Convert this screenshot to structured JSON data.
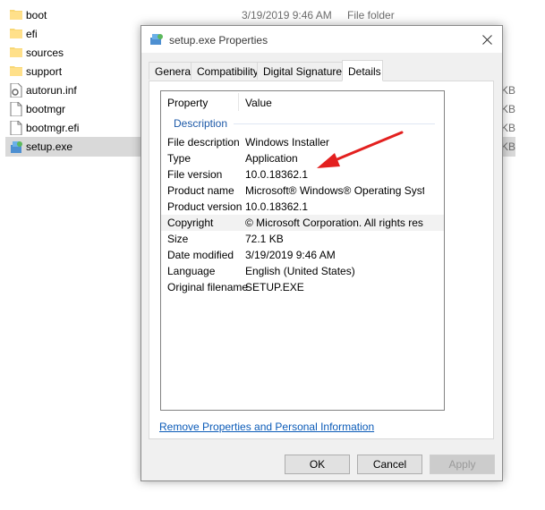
{
  "explorer": {
    "files": [
      {
        "name": "boot",
        "date": "3/19/2019 9:46 AM",
        "type": "File folder",
        "size": "",
        "icon": "folder-icon"
      },
      {
        "name": "efi",
        "date": "",
        "type": "",
        "size": "",
        "icon": "folder-icon"
      },
      {
        "name": "sources",
        "date": "",
        "type": "",
        "size": "",
        "icon": "folder-icon"
      },
      {
        "name": "support",
        "date": "",
        "type": "",
        "size": "",
        "icon": "folder-icon"
      },
      {
        "name": "autorun.inf",
        "date": "",
        "type": "",
        "size": "KB",
        "icon": "settings-file-icon"
      },
      {
        "name": "bootmgr",
        "date": "",
        "type": "",
        "size": "KB",
        "icon": "file-icon"
      },
      {
        "name": "bootmgr.efi",
        "date": "",
        "type": "",
        "size": "KB",
        "icon": "file-icon"
      },
      {
        "name": "setup.exe",
        "date": "",
        "type": "",
        "size": "KB",
        "icon": "setup-exe-icon",
        "selected": true
      }
    ]
  },
  "dialog": {
    "title": "setup.exe Properties",
    "tabs": [
      {
        "label": "General",
        "active": false
      },
      {
        "label": "Compatibility",
        "active": false
      },
      {
        "label": "Digital Signatures",
        "active": false
      },
      {
        "label": "Details",
        "active": true
      }
    ],
    "details": {
      "column_property": "Property",
      "column_value": "Value",
      "section": "Description",
      "rows": [
        {
          "name": "File description",
          "value": "Windows Installer"
        },
        {
          "name": "Type",
          "value": "Application"
        },
        {
          "name": "File version",
          "value": "10.0.18362.1"
        },
        {
          "name": "Product name",
          "value": "Microsoft® Windows® Operating Syst..."
        },
        {
          "name": "Product version",
          "value": "10.0.18362.1"
        },
        {
          "name": "Copyright",
          "value": "© Microsoft Corporation. All rights res...",
          "highlight": true
        },
        {
          "name": "Size",
          "value": "72.1 KB"
        },
        {
          "name": "Date modified",
          "value": "3/19/2019 9:46 AM"
        },
        {
          "name": "Language",
          "value": "English (United States)"
        },
        {
          "name": "Original filename",
          "value": "SETUP.EXE"
        }
      ]
    },
    "remove_link": "Remove Properties and Personal Information",
    "buttons": {
      "ok": "OK",
      "cancel": "Cancel",
      "apply": "Apply"
    }
  },
  "colors": {
    "link": "#0b5bb8",
    "section": "#1e5aa8",
    "arrow": "#e3201f",
    "selection": "#d9d9d9"
  }
}
